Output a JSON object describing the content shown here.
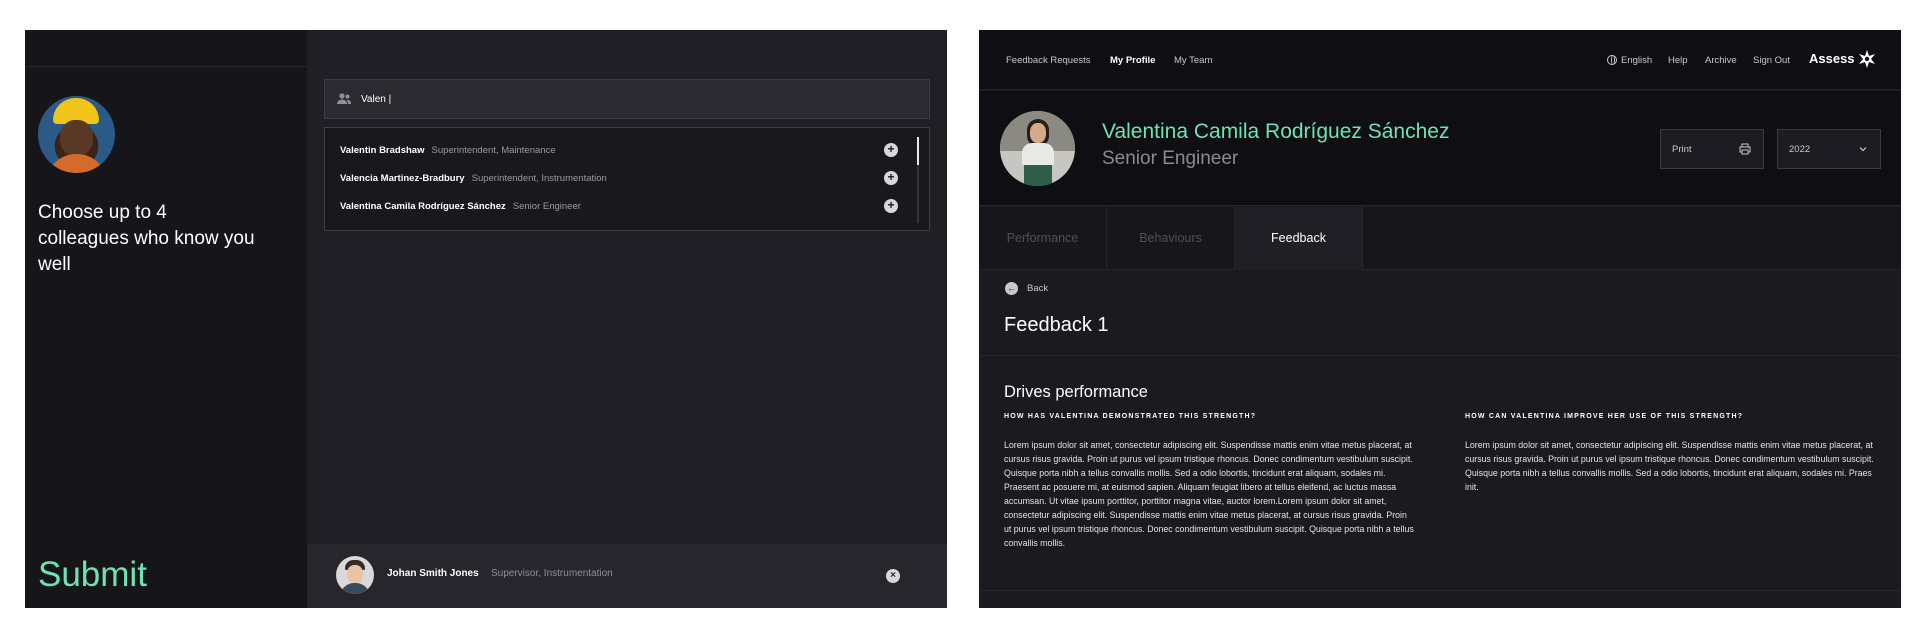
{
  "left": {
    "heading": "Choose up to 4 colleagues who know you well",
    "submit_label": "Submit",
    "search": {
      "value": "Valen |"
    },
    "results": [
      {
        "name": "Valentin Bradshaw",
        "role": "Superintendent, Maintenance"
      },
      {
        "name": "Valencia Martinez-Bradbury",
        "role": "Superintendent, Instrumentation"
      },
      {
        "name": "Valentina Camila Rodríguez Sánchez",
        "role": "Senior Engineer"
      }
    ],
    "selected": {
      "name": "Johan Smith Jones",
      "role": "Supervisor, Instrumentation"
    }
  },
  "right": {
    "nav": {
      "feedback_requests": "Feedback Requests",
      "my_profile": "My Profile",
      "my_team": "My Team",
      "language": "English",
      "help": "Help",
      "archive": "Archive",
      "sign_out": "Sign Out",
      "brand": "Assess"
    },
    "profile": {
      "name": "Valentina Camila Rodríguez Sánchez",
      "title": "Senior Engineer",
      "print_label": "Print",
      "year": "2022"
    },
    "tabs": [
      "Performance",
      "Behaviours",
      "Feedback"
    ],
    "back_label": "Back",
    "feedback_title": "Feedback 1",
    "section_title": "Drives performance",
    "q1": "HOW HAS VALENTINA DEMONSTRATED THIS STRENGTH?",
    "q2": "HOW CAN VALENTINA IMPROVE HER USE OF THIS STRENGTH?",
    "a1": "Lorem ipsum dolor sit amet, consectetur adipiscing elit. Suspendisse mattis enim vitae metus placerat, at cursus risus gravida. Proin ut purus vel ipsum tristique rhoncus. Donec condimentum vestibulum suscipit. Quisque porta nibh a tellus convallis mollis. Sed a odio lobortis, tincidunt erat aliquam, sodales mi. Praesent ac posuere mi, at euismod sapien. Aliquam feugiat libero at tellus eleifend, ac luctus massa accumsan. Ut vitae ipsum porttitor, porttitor magna vitae, auctor lorem.Lorem ipsum dolor sit amet, consectetur adipiscing elit. Suspendisse mattis enim vitae metus placerat, at cursus risus gravida. Proin ut purus vel ipsum tristique rhoncus. Donec condimentum vestibulum suscipit. Quisque porta nibh a tellus convallis mollis.",
    "a2": "Lorem ipsum dolor sit amet, consectetur adipiscing elit. Suspendisse mattis enim vitae metus placerat, at cursus risus gravida. Proin ut purus vel ipsum tristique rhoncus. Donec condimentum vestibulum suscipit. Quisque porta nibh a tellus convallis mollis. Sed a odio lobortis, tincidunt erat aliquam, sodales mi. Praes init."
  },
  "colors": {
    "accent": "#6fe3b4",
    "background": "#1a1a1f"
  }
}
